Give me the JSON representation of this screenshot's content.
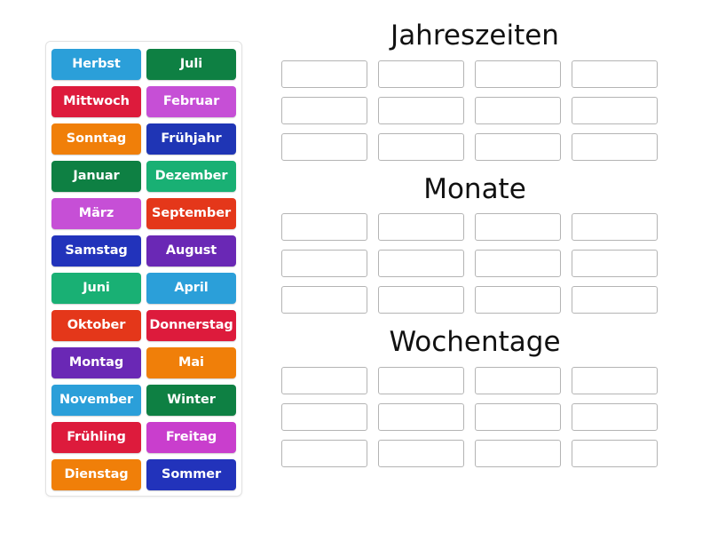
{
  "activity": {
    "type": "group-sort",
    "title": "Jahreszeiten, Monate, Wochentage"
  },
  "colors": {
    "light_blue": "#2b9fd9",
    "dark_green": "#0e8043",
    "crimson": "#dd1b3c",
    "orchid": "#c64fd6",
    "orange": "#f07f09",
    "royal_blue": "#1f35b5",
    "emerald": "#19b074",
    "violet": "#6a28b5",
    "vermilion": "#e4371a",
    "magenta": "#c93ecd",
    "panel_border": "#e2e2e2",
    "slot_border": "#b4b4b4",
    "heading_text": "#111111",
    "tile_text": "#ffffff",
    "background": "#ffffff"
  },
  "tile_panel": {
    "name": "word-bank",
    "tiles": [
      {
        "label": "Herbst",
        "color": "#2b9fd9"
      },
      {
        "label": "Juli",
        "color": "#0e8043"
      },
      {
        "label": "Mittwoch",
        "color": "#dd1b3c"
      },
      {
        "label": "Februar",
        "color": "#c64fd6"
      },
      {
        "label": "Sonntag",
        "color": "#f07f09"
      },
      {
        "label": "Frühjahr",
        "color": "#1f35b5"
      },
      {
        "label": "Januar",
        "color": "#0e8043"
      },
      {
        "label": "Dezember",
        "color": "#19b074"
      },
      {
        "label": "März",
        "color": "#c64fd6"
      },
      {
        "label": "September",
        "color": "#e4371a"
      },
      {
        "label": "Samstag",
        "color": "#2233bb"
      },
      {
        "label": "August",
        "color": "#6a28b5"
      },
      {
        "label": "Juni",
        "color": "#19b074"
      },
      {
        "label": "April",
        "color": "#2b9fd9"
      },
      {
        "label": "Oktober",
        "color": "#e4371a"
      },
      {
        "label": "Donnerstag",
        "color": "#dd1b3c"
      },
      {
        "label": "Montag",
        "color": "#6a28b5"
      },
      {
        "label": "Mai",
        "color": "#f07f09"
      },
      {
        "label": "November",
        "color": "#2b9fd9"
      },
      {
        "label": "Winter",
        "color": "#0e8043"
      },
      {
        "label": "Frühling",
        "color": "#dd1b3c"
      },
      {
        "label": "Freitag",
        "color": "#c93ecd"
      },
      {
        "label": "Dienstag",
        "color": "#f07f09"
      },
      {
        "label": "Sommer",
        "color": "#2233bb"
      }
    ]
  },
  "categories": [
    {
      "name": "jahreszeiten",
      "title": "Jahreszeiten",
      "rows": 3,
      "columns": 4,
      "slots": [
        "",
        "",
        "",
        "",
        "",
        "",
        "",
        "",
        "",
        "",
        "",
        ""
      ]
    },
    {
      "name": "monate",
      "title": "Monate",
      "rows": 3,
      "columns": 4,
      "slots": [
        "",
        "",
        "",
        "",
        "",
        "",
        "",
        "",
        "",
        "",
        "",
        ""
      ]
    },
    {
      "name": "wochentage",
      "title": "Wochentage",
      "rows": 3,
      "columns": 4,
      "slots": [
        "",
        "",
        "",
        "",
        "",
        "",
        "",
        "",
        "",
        "",
        "",
        ""
      ]
    }
  ]
}
